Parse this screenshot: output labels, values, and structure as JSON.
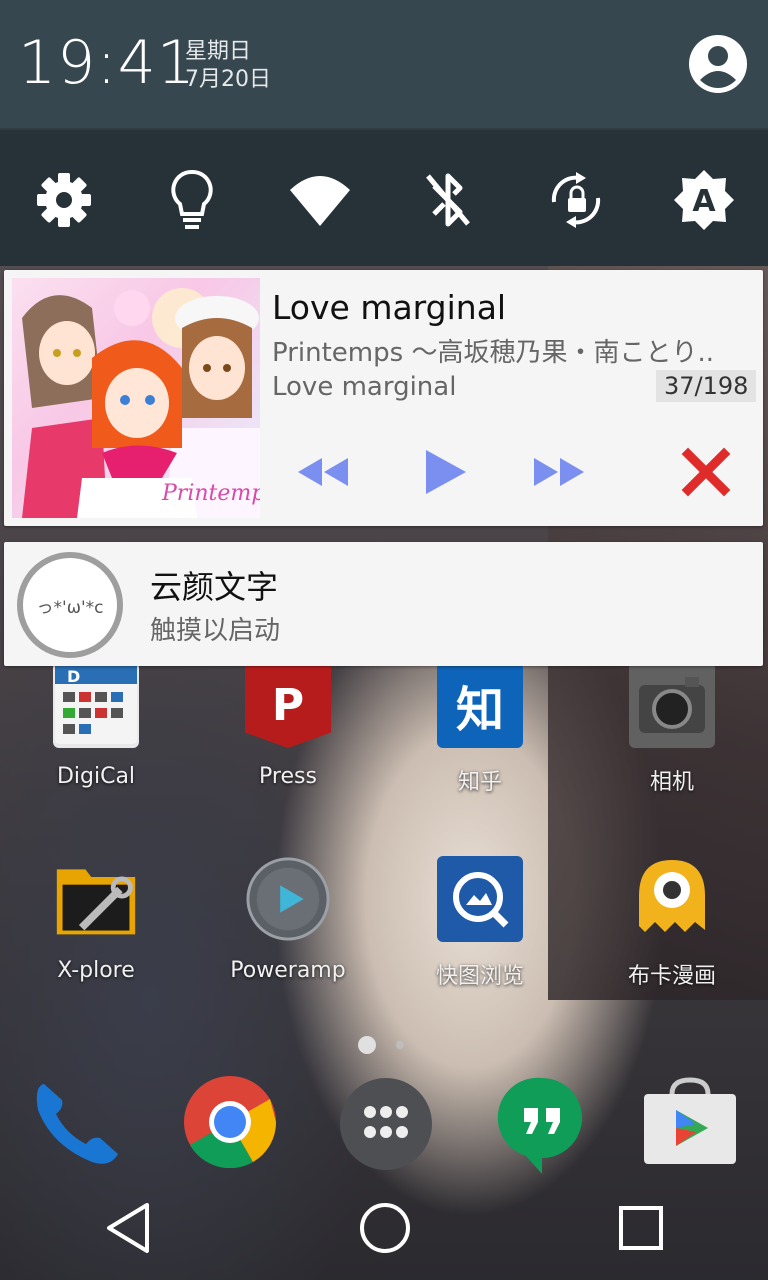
{
  "status": {
    "time": "19:41",
    "weekday": "星期日",
    "date": "7月20日",
    "profile_icon": "account-circle-icon"
  },
  "quick_settings": [
    {
      "name": "settings",
      "icon": "gear-icon"
    },
    {
      "name": "flashlight",
      "icon": "bulb-icon"
    },
    {
      "name": "wifi",
      "icon": "wifi-icon"
    },
    {
      "name": "bluetooth",
      "icon": "bluetooth-off-icon"
    },
    {
      "name": "rotation",
      "icon": "rotation-lock-icon"
    },
    {
      "name": "auto-brightness",
      "icon": "brightness-auto-icon"
    }
  ],
  "music_notification": {
    "title": "Love marginal",
    "artist": "Printemps ～高坂穂乃果・南ことり..",
    "album": "Love marginal",
    "track_counter": "37/198",
    "album_art_text": "Printemps",
    "controls": [
      "previous",
      "play",
      "next",
      "close"
    ],
    "accent_color": "#7b8ff0",
    "close_color": "#e02b2b"
  },
  "app_notification": {
    "icon_text": "っ*'ω'*c",
    "title": "云颜文字",
    "text": "触摸以启动"
  },
  "home_apps": [
    {
      "label": "DigiCal"
    },
    {
      "label": "Press"
    },
    {
      "label": "知乎"
    },
    {
      "label": "相机"
    },
    {
      "label": "X-plore"
    },
    {
      "label": "Poweramp"
    },
    {
      "label": "快图浏览"
    },
    {
      "label": "布卡漫画"
    }
  ],
  "dock": [
    "phone",
    "chrome",
    "app-drawer",
    "hangouts",
    "play-store"
  ],
  "navbar": [
    "back",
    "home",
    "recents"
  ]
}
